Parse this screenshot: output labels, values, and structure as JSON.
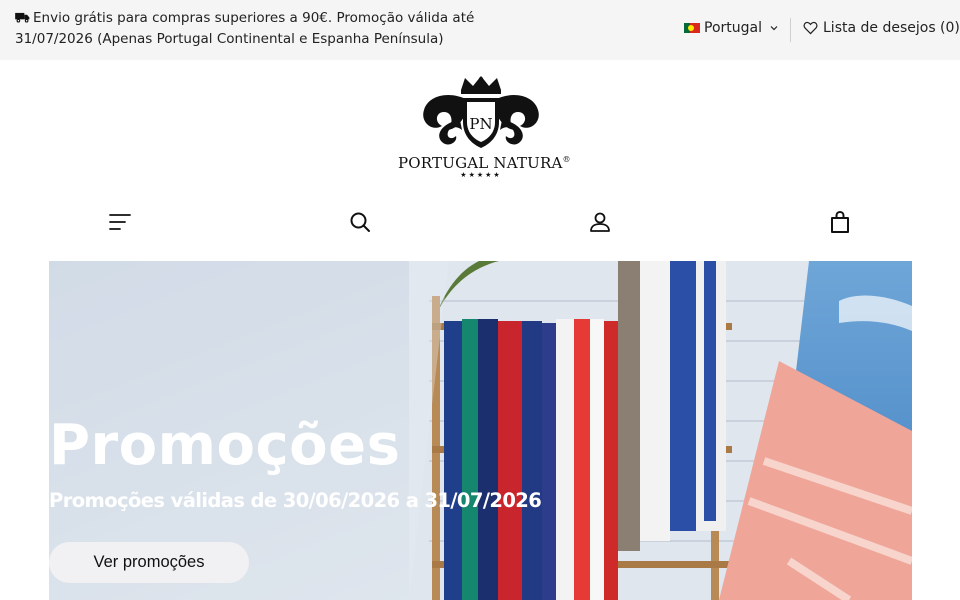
{
  "announcement": {
    "text": "Envio grátis para compras superiores a 90€. Promoção válida até 31/07/2026 (Apenas Portugal Continental e Espanha Península)",
    "icon": "truck-icon"
  },
  "language_selector": {
    "flag": "portugal-flag-icon",
    "label": "Portugal",
    "icon": "chevron-down-icon"
  },
  "wishlist": {
    "label": "Lista de desejos (0)",
    "icon": "heart-icon"
  },
  "logo": {
    "monogram": "PN",
    "brand": "PORTUGAL NATURA",
    "registered": "®",
    "stars": "★★★★★"
  },
  "nav": {
    "icons": [
      "menu-icon",
      "search-icon",
      "account-icon",
      "shopping-bag-icon"
    ]
  },
  "hero": {
    "title": "Promoções",
    "subtitle": "Promoções válidas de 30/06/2026 a 31/07/2026",
    "button_label": "Ver promoções"
  },
  "colors": {
    "topbar_bg": "#f5f5f5",
    "button_bg": "#f1f1f4",
    "text": "#222222"
  }
}
